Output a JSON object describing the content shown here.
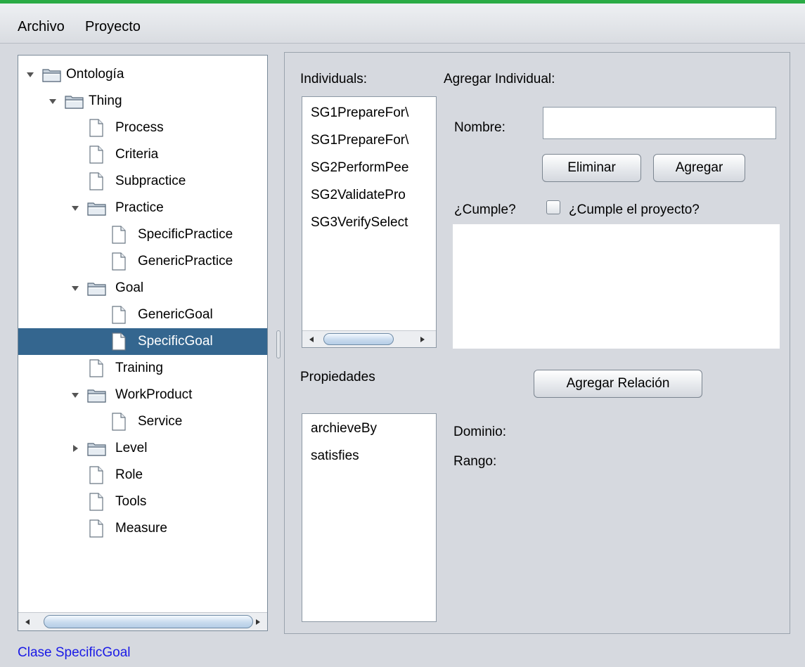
{
  "menu": {
    "archivo": "Archivo",
    "proyecto": "Proyecto"
  },
  "tree": {
    "nodes": [
      {
        "label": "Ontología"
      },
      {
        "label": "Thing"
      },
      {
        "label": "Process"
      },
      {
        "label": "Criteria"
      },
      {
        "label": "Subpractice"
      },
      {
        "label": "Practice"
      },
      {
        "label": "SpecificPractice"
      },
      {
        "label": "GenericPractice"
      },
      {
        "label": "Goal"
      },
      {
        "label": "GenericGoal"
      },
      {
        "label": "SpecificGoal"
      },
      {
        "label": "Training"
      },
      {
        "label": "WorkProduct"
      },
      {
        "label": "Service"
      },
      {
        "label": "Level"
      },
      {
        "label": "Role"
      },
      {
        "label": "Tools"
      },
      {
        "label": "Measure"
      }
    ]
  },
  "individuals": {
    "label": "Individuals:",
    "items": [
      "SG1PrepareFor\\",
      "SG1PrepareFor\\",
      "SG2PerformPee",
      "SG2ValidatePro",
      "SG3VerifySelect"
    ]
  },
  "agregar": {
    "title": "Agregar Individual:",
    "nombre_label": "Nombre:",
    "nombre_value": "",
    "eliminar_label": "Eliminar",
    "agregar_label": "Agregar",
    "cumple_label": "¿Cumple?",
    "cumple_proyecto_label": "¿Cumple el proyecto?",
    "cumple_checked": false
  },
  "propiedades": {
    "label": "Propiedades",
    "items": [
      "archieveBy",
      "satisfies"
    ]
  },
  "relacion": {
    "button_label": "Agregar Relación"
  },
  "info": {
    "dominio_label": "Dominio:",
    "rango_label": "Rango:"
  },
  "status": {
    "text": "Clase SpecificGoal"
  },
  "colors": {
    "accent_green": "#2aab45",
    "selection": "#34668f",
    "status_blue": "#1a1ae6"
  }
}
